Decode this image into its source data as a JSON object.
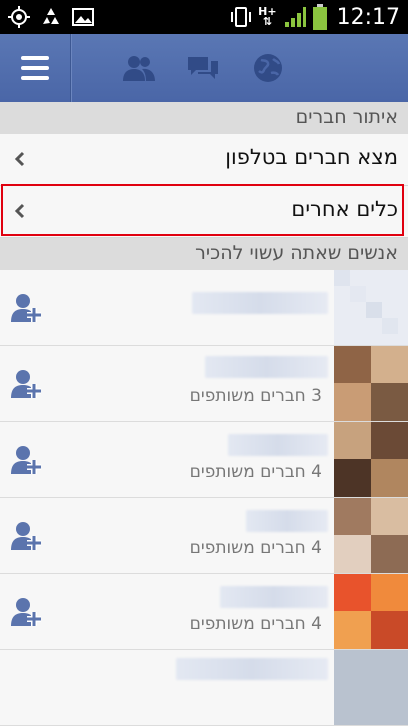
{
  "status_bar": {
    "time": "12:17",
    "left_icons": [
      "gps-icon",
      "recycle-icon",
      "gallery-icon"
    ],
    "right_icons": [
      "vibrate-icon",
      "hplus-network-icon",
      "signal-icon",
      "battery-icon"
    ],
    "network_label": "H+"
  },
  "nav": {
    "icons": [
      "menu-icon",
      "friend-requests-icon",
      "messages-icon",
      "notifications-globe-icon"
    ]
  },
  "section_find_friends": {
    "title": "איתור חברים"
  },
  "find_rows": [
    {
      "label": "מצא חברים בטלפון"
    },
    {
      "label": "כלים אחרים"
    }
  ],
  "section_pymk": {
    "title": "אנשים שאתה עשוי להכיר"
  },
  "people": [
    {
      "mutual": ""
    },
    {
      "mutual": "3 חברים משותפים"
    },
    {
      "mutual": "4 חברים משותפים"
    },
    {
      "mutual": "4 חברים משותפים"
    },
    {
      "mutual": "4 חברים משותפים"
    },
    {
      "mutual": ""
    }
  ],
  "colors": {
    "nav_blue": "#4a66a7",
    "highlight_red": "#e0000f",
    "battery_green": "#8bc53f"
  }
}
